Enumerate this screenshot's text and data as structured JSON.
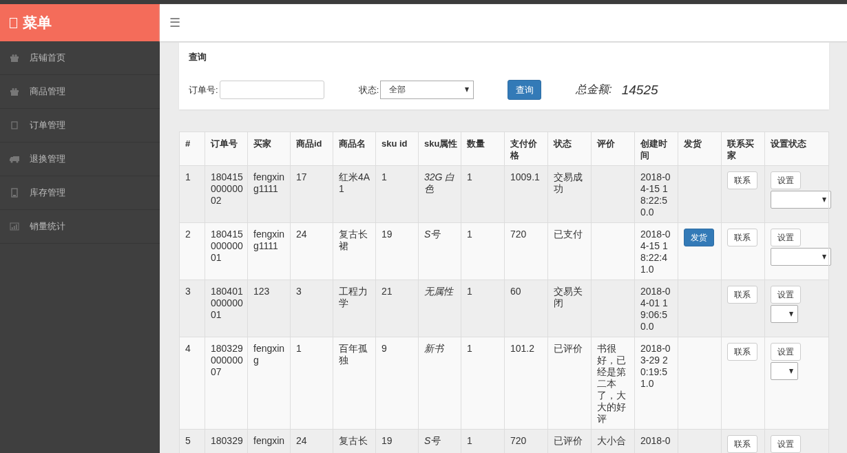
{
  "sidebar": {
    "title": "菜单",
    "items": [
      {
        "label": "店铺首页"
      },
      {
        "label": "商品管理"
      },
      {
        "label": "订单管理"
      },
      {
        "label": "退换管理"
      },
      {
        "label": "库存管理"
      },
      {
        "label": "销量统计"
      }
    ]
  },
  "header": {
    "menu_icon": "☰"
  },
  "query": {
    "title": "查询",
    "order_label": "订单号:",
    "status_label": "状态:",
    "status_value": "全部",
    "button": "查询",
    "total_label": "总金额:",
    "total_value": "14525"
  },
  "table": {
    "columns": [
      "#",
      "订单号",
      "买家",
      "商品id",
      "商品名",
      "sku id",
      "sku属性",
      "数量",
      "支付价格",
      "状态",
      "评价",
      "创建时间",
      "发货",
      "联系买家",
      "设置状态"
    ],
    "rows": [
      {
        "cells": [
          "1",
          "18041500000002",
          "fengxing1111",
          "17",
          "红米4A1",
          "1",
          "32G 白色",
          "1",
          "1009.1",
          "交易成功",
          null,
          "2018-04-15 18:22:50.0"
        ],
        "contact": "联系",
        "set": "设置",
        "select_wide": true
      },
      {
        "cells": [
          "2",
          "18041500000001",
          "fengxing1111",
          "24",
          "复古长裙",
          "19",
          "S号",
          "1",
          "720",
          "已支付",
          null,
          "2018-04-15 18:22:41.0"
        ],
        "ship": "发货",
        "contact": "联系",
        "set": "设置",
        "select_wide": true
      },
      {
        "cells": [
          "3",
          "18040100000001",
          "123",
          "3",
          "工程力学",
          "21",
          "无属性",
          "1",
          "60",
          "交易关闭",
          null,
          "2018-04-01 19:06:50.0"
        ],
        "contact": "联系",
        "set": "设置",
        "select_wide": false
      },
      {
        "cells": [
          "4",
          "18032900000007",
          "fengxing",
          "1",
          "百年孤独",
          "9",
          "新书",
          "1",
          "101.2",
          "已评价",
          "书很好，已经是第二本了，大大的好评",
          "2018-03-29 20:19:51.0"
        ],
        "contact": "联系",
        "set": "设置",
        "select_wide": false
      },
      {
        "cells": [
          "5",
          "180329",
          "fengxin",
          "24",
          "复古长",
          "19",
          "S号",
          "1",
          "720",
          "已评价",
          "大小合",
          "2018-0"
        ],
        "contact": "联系",
        "set": "设置"
      }
    ]
  }
}
